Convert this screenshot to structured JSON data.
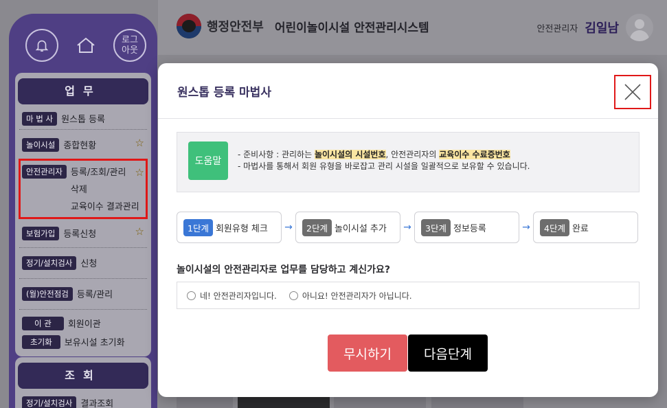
{
  "header": {
    "gov_name": "행정안전부",
    "system_name": "어린이놀이시설 안전관리시스템",
    "user_role": "안전관리자",
    "user_name": "김일남"
  },
  "sidebar": {
    "logout_label": "로그\n아웃",
    "work_title": "업무",
    "work_items": [
      {
        "tag": "마 법 사",
        "lines": [
          "원스톱 등록"
        ],
        "star": false
      },
      {
        "tag": "놀이시설",
        "lines": [
          "종합현황"
        ],
        "star": true
      },
      {
        "tag": "안전관리자",
        "lines": [
          "등록/조회/관리",
          "삭제",
          "교육이수 결과관리"
        ],
        "star": true
      },
      {
        "tag": "보험가입",
        "lines": [
          "등록신청"
        ],
        "star": true
      },
      {
        "tag": "정기/설치검사",
        "lines": [
          "신청"
        ],
        "star": false
      },
      {
        "tag": "(월)안전점검",
        "lines": [
          "등록/관리"
        ],
        "star": false
      },
      {
        "tag": "이 관",
        "lines": [
          "회원이관"
        ],
        "star": false
      },
      {
        "tag": "초기화",
        "lines": [
          "보유시설 초기화"
        ],
        "star": false
      }
    ],
    "view_title": "조회",
    "view_items": [
      {
        "tag": "정기/설치검사",
        "lines": [
          "결과조회"
        ]
      }
    ]
  },
  "modal": {
    "title": "원스톱 등록 마법사",
    "help_badge": "도움말",
    "help_line1_prefix": "- 준비사항 : 관리하는 ",
    "help_line1_hl1": "놀이시설의 시설번호",
    "help_line1_mid": ", 안전관리자의 ",
    "help_line1_hl2": "교육이수 수료증번호",
    "help_line2": "- 마법사를 통해서 회원 유형을 바로잡고 관리 시설을 일괄적으로 보유할 수 있습니다.",
    "steps": [
      {
        "num": "1단계",
        "label": "회원유형 체크",
        "active": true
      },
      {
        "num": "2단계",
        "label": "놀이시설 추가",
        "active": false
      },
      {
        "num": "3단계",
        "label": "정보등록",
        "active": false
      },
      {
        "num": "4단계",
        "label": "완료",
        "active": false
      }
    ],
    "arrow": "→",
    "question": "놀이시설의 안전관리자로 업무를 담당하고 계신가요?",
    "option_yes": "네! 안전관리자입니다.",
    "option_no": "아니요! 안전관리자가 아닙니다.",
    "ignore_label": "무시하기",
    "next_label": "다음단계"
  },
  "colors": {
    "accent_blue": "#3a77d6",
    "help_green": "#3fc07b",
    "ignore_red": "#e35b5f",
    "highlight_red": "#e01818"
  }
}
